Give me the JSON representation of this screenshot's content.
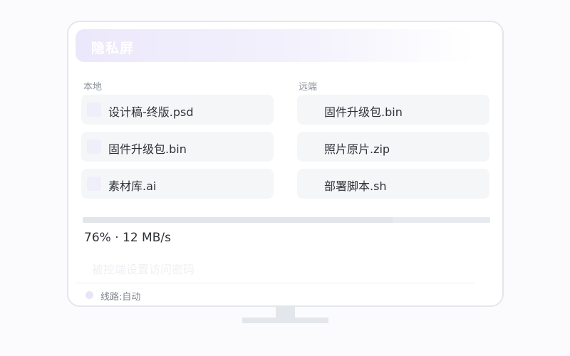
{
  "header": {
    "title": "隐私屏"
  },
  "local": {
    "title": "本地",
    "files": [
      "设计稿-终版.psd",
      "固件升级包.bin",
      "素材库.ai"
    ]
  },
  "remote": {
    "title": "远端",
    "files": [
      "固件升级包.bin",
      "照片原片.zip",
      "部署脚本.sh"
    ]
  },
  "transfer": {
    "progress_percent": 76,
    "status_text": "76% · 12 MB/s"
  },
  "access_hint": "被控端设置访问密码",
  "route": {
    "label": "线路:自动"
  },
  "colors": {
    "accent_light": "#ece8fb",
    "card_bg": "#f5f6f8",
    "frame": "#e3e6ea",
    "text": "#2e3238",
    "muted": "#8b929b"
  }
}
